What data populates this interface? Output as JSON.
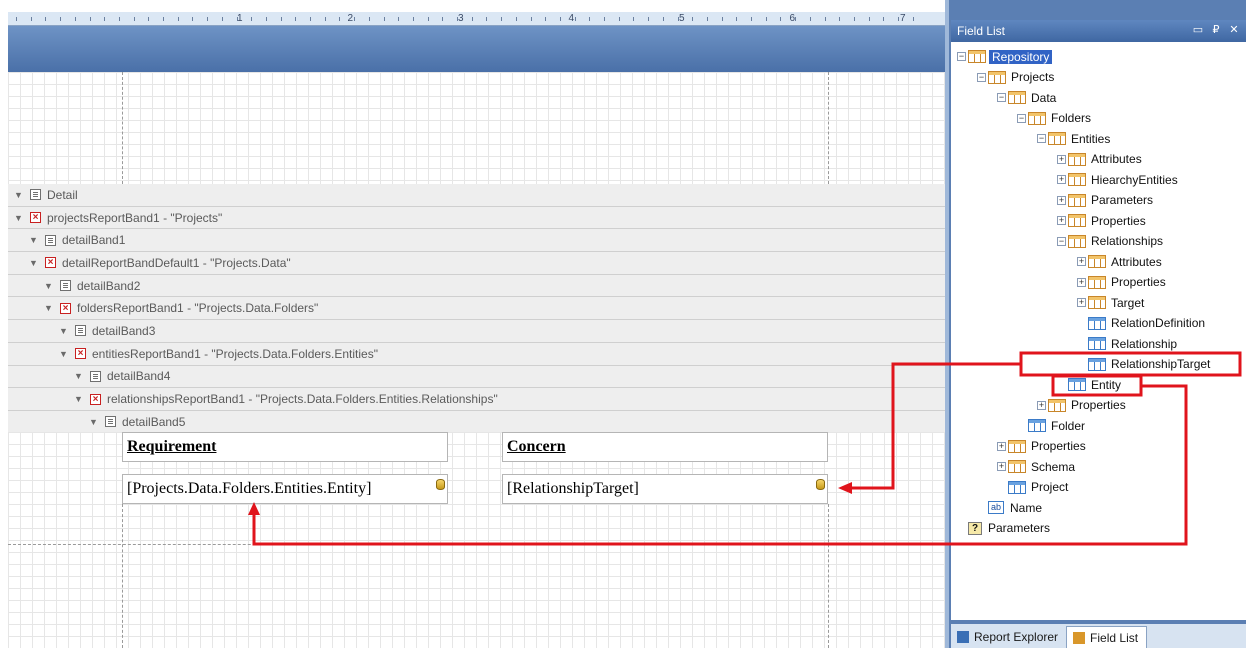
{
  "ruler": {
    "numbers": [
      "1",
      "2",
      "3",
      "4",
      "5",
      "6",
      "7"
    ]
  },
  "bands": [
    {
      "type": "detail",
      "label": "Detail",
      "indent": 0
    },
    {
      "type": "report",
      "label": "projectsReportBand1 - \"Projects\"",
      "indent": 0
    },
    {
      "type": "detail",
      "label": "detailBand1",
      "indent": 1
    },
    {
      "type": "report",
      "label": "detailReportBandDefault1 - \"Projects.Data\"",
      "indent": 1
    },
    {
      "type": "detail",
      "label": "detailBand2",
      "indent": 2
    },
    {
      "type": "report",
      "label": "foldersReportBand1 - \"Projects.Data.Folders\"",
      "indent": 2
    },
    {
      "type": "detail",
      "label": "detailBand3",
      "indent": 3
    },
    {
      "type": "report",
      "label": "entitiesReportBand1 - \"Projects.Data.Folders.Entities\"",
      "indent": 3
    },
    {
      "type": "detail",
      "label": "detailBand4",
      "indent": 4
    },
    {
      "type": "report",
      "label": "relationshipsReportBand1 - \"Projects.Data.Folders.Entities.Relationships\"",
      "indent": 4
    },
    {
      "type": "detail",
      "label": "detailBand5",
      "indent": 5
    }
  ],
  "report": {
    "header_left": "Requirement",
    "header_right": "Concern",
    "field_left": "[Projects.Data.Folders.Entities.Entity]",
    "field_right": "[RelationshipTarget]"
  },
  "panel": {
    "title": "Field List",
    "buttons": {
      "minimize": "▭",
      "pin": "₽",
      "close": "✕"
    },
    "tree": [
      {
        "label": "Repository",
        "icon": "table",
        "selected": true
      },
      {
        "label": "Projects",
        "icon": "table"
      },
      {
        "label": "Data",
        "icon": "table"
      },
      {
        "label": "Folders",
        "icon": "table"
      },
      {
        "label": "Entities",
        "icon": "table"
      },
      {
        "label": "Attributes",
        "icon": "table"
      },
      {
        "label": "HiearchyEntities",
        "icon": "table"
      },
      {
        "label": "Parameters",
        "icon": "table"
      },
      {
        "label": "Properties",
        "icon": "table"
      },
      {
        "label": "Relationships",
        "icon": "table"
      },
      {
        "label": "Attributes",
        "icon": "table"
      },
      {
        "label": "Properties",
        "icon": "table"
      },
      {
        "label": "Target",
        "icon": "table"
      },
      {
        "label": "RelationDefinition",
        "icon": "table-blue"
      },
      {
        "label": "Relationship",
        "icon": "table-blue"
      },
      {
        "label": "RelationshipTarget",
        "icon": "table-blue"
      },
      {
        "label": "Entity",
        "icon": "table-blue"
      },
      {
        "label": "Properties",
        "icon": "table"
      },
      {
        "label": "Folder",
        "icon": "table-blue"
      },
      {
        "label": "Properties",
        "icon": "table"
      },
      {
        "label": "Schema",
        "icon": "table"
      },
      {
        "label": "Project",
        "icon": "table-blue"
      },
      {
        "label": "Name",
        "icon": "ab"
      },
      {
        "label": "Parameters",
        "icon": "question"
      }
    ],
    "tabs": [
      {
        "label": "Report Explorer",
        "active": false
      },
      {
        "label": "Field List",
        "active": true
      }
    ]
  },
  "colors": {
    "highlight": "#e0141c",
    "selection": "#3163c5"
  }
}
